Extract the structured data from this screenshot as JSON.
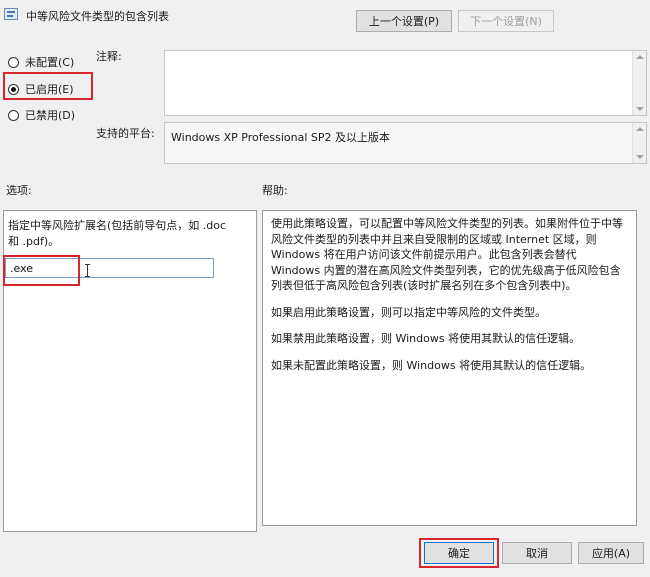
{
  "window": {
    "title": "中等风险文件类型的包含列表"
  },
  "nav": {
    "prev_label": "上一个设置(P)",
    "next_label": "下一个设置(N)"
  },
  "state": {
    "options": [
      {
        "label": "未配置(C)",
        "checked": false
      },
      {
        "label": "已启用(E)",
        "checked": true
      },
      {
        "label": "已禁用(D)",
        "checked": false
      }
    ]
  },
  "comment": {
    "label": "注释:",
    "value": ""
  },
  "platform": {
    "label": "支持的平台:",
    "value": "Windows XP Professional SP2 及以上版本"
  },
  "options_section": {
    "label": "选项:",
    "description_line1": "指定中等风险扩展名(包括前导句点，如 .doc",
    "description_line2": "和 .pdf)。",
    "input_value": ".exe"
  },
  "help_section": {
    "label": "帮助:",
    "paragraphs": [
      [
        "使用此策略设置，可以配置中等风险文件类型的列表。如果附件位于中等",
        "风险文件类型的列表中并且来自受限制的区域或 Internet 区域，则",
        "Windows 将在用户访问该文件前提示用户。此包含列表会替代",
        "Windows 内置的潜在高风险文件类型列表，它的优先级高于低风险包含",
        "列表但低于高风险包含列表(该时扩展名列在多个包含列表中)。"
      ],
      [
        "如果启用此策略设置，则可以指定中等风险的文件类型。"
      ],
      [
        "如果禁用此策略设置，则 Windows 将使用其默认的信任逻辑。"
      ],
      [
        "如果未配置此策略设置，则 Windows 将使用其默认的信任逻辑。"
      ]
    ]
  },
  "footer": {
    "ok_label": "确定",
    "cancel_label": "取消",
    "apply_label": "应用(A)"
  },
  "colors": {
    "highlight": "#d9262c",
    "input_border": "#7a9fc9"
  }
}
